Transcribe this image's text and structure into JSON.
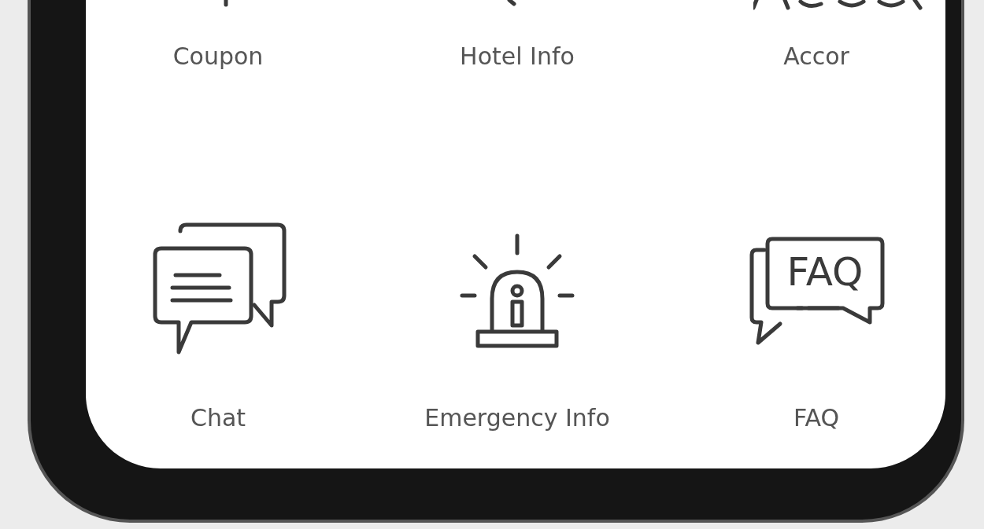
{
  "menu_items": [
    {
      "kind": "coupon",
      "label": "Coupon"
    },
    {
      "kind": "hotel",
      "label": "Hotel Info"
    },
    {
      "kind": "brand",
      "label": "Accor"
    },
    {
      "kind": "chat",
      "label": "Chat"
    },
    {
      "kind": "emergency",
      "label": "Emergency Info"
    },
    {
      "kind": "faq",
      "label": "FAQ",
      "icon_text": "FAQ"
    }
  ]
}
